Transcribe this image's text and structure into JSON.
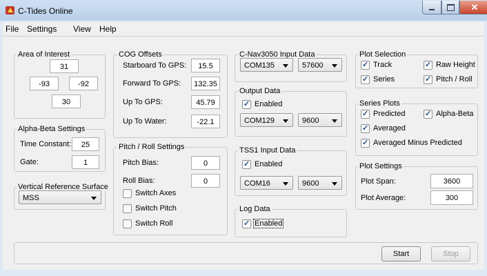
{
  "window": {
    "title": "C-Tides Online"
  },
  "menu": [
    "File",
    "Settings",
    "View",
    "Help"
  ],
  "area_of_interest": {
    "label": "Area of Interest",
    "north": "31",
    "west": "-93",
    "east": "-92",
    "south": "30"
  },
  "alpha_beta": {
    "label": "Alpha-Beta Settings",
    "time_constant_label": "Time Constant:",
    "time_constant": "25",
    "gate_label": "Gate:",
    "gate": "1"
  },
  "vertical_reference": {
    "label": "Vertical Reference Surface",
    "value": "MSS"
  },
  "cog_offsets": {
    "label": "COG Offsets",
    "starboard_label": "Starboard To GPS:",
    "starboard": "15.5",
    "forward_label": "Forward To GPS:",
    "forward": "132.35",
    "up_gps_label": "Up To GPS:",
    "up_gps": "45.79",
    "up_water_label": "Up To Water:",
    "up_water": "-22.1"
  },
  "pitch_roll": {
    "label": "Pitch / Roll Settings",
    "pitch_bias_label": "Pitch Bias:",
    "pitch_bias": "0",
    "roll_bias_label": "Roll Bias:",
    "roll_bias": "0",
    "switch_axes": "Switch Axes",
    "switch_pitch": "Switch Pitch",
    "switch_roll": "Switch Roll"
  },
  "cnav_input": {
    "label": "C-Nav3050 Input Data",
    "port": "COM135",
    "baud": "57600"
  },
  "output_data": {
    "label": "Output Data",
    "enabled": "Enabled",
    "port": "COM129",
    "baud": "9600"
  },
  "tss1_input": {
    "label": "TSS1 Input Data",
    "enabled": "Enabled",
    "port": "COM16",
    "baud": "9600"
  },
  "log_data": {
    "label": "Log Data",
    "enabled": "Enabled"
  },
  "plot_selection": {
    "label": "Plot Selection",
    "track": "Track",
    "raw_height": "Raw Height",
    "series": "Series",
    "pitch_roll": "Pitch / Roll"
  },
  "series_plots": {
    "label": "Series Plots",
    "predicted": "Predicted",
    "alpha_beta": "Alpha-Beta",
    "averaged": "Averaged",
    "averaged_minus_predicted": "Averaged Minus Predicted"
  },
  "plot_settings": {
    "label": "Plot Settings",
    "span_label": "Plot Span:",
    "span": "3600",
    "average_label": "Plot Average:",
    "average": "300"
  },
  "actions": {
    "start": "Start",
    "stop": "Stop"
  }
}
